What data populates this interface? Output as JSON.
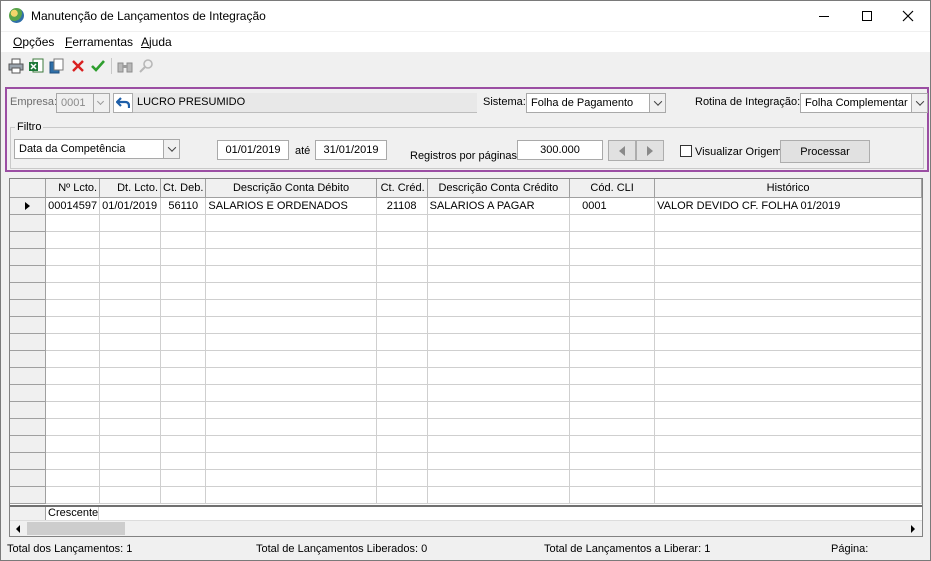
{
  "window": {
    "title": "Manutenção de Lançamentos de Integração"
  },
  "menu": {
    "items": [
      {
        "label": "Opções",
        "mnemonic": "O",
        "rest": "pções"
      },
      {
        "label": "Ferramentas",
        "mnemonic": "F",
        "rest": "erramentas"
      },
      {
        "label": "Ajuda",
        "mnemonic": "A",
        "rest": "juda"
      }
    ]
  },
  "toolbar": {
    "icons": [
      "print-icon",
      "excel-export-icon",
      "copy-icon",
      "cancel-icon",
      "confirm-icon",
      "binoculars-icon",
      "magnifier-icon"
    ]
  },
  "filter": {
    "empresa_label": "Empresa:",
    "empresa_code": "0001",
    "empresa_name": "LUCRO PRESUMIDO",
    "sistema_label": "Sistema:",
    "sistema_value": "Folha de Pagamento",
    "rotina_label": "Rotina de Integração:",
    "rotina_value": "Folha Complementar",
    "group_label": "Filtro",
    "date_type": "Data da Competência",
    "date_from": "01/01/2019",
    "ate_label": "até",
    "date_to": "31/01/2019",
    "registros_label": "Registros por páginas:",
    "registros_value": "300.000",
    "visualizar_label": "Visualizar Origem",
    "processar_label": "Processar"
  },
  "grid": {
    "columns": [
      "Nº Lcto.",
      "Dt. Lcto.",
      "Ct. Deb.",
      "Descrição Conta Débito",
      "Ct. Créd.",
      "Descrição Conta Crédito",
      "Cód. CLI",
      "Histórico"
    ],
    "rows": [
      [
        "00014597",
        "01/01/2019",
        "56110",
        "SALARIOS E ORDENADOS",
        "21108",
        "SALARIOS A PAGAR",
        "0001",
        "VALOR DEVIDO CF. FOLHA 01/2019"
      ]
    ],
    "footer_label": "Crescente"
  },
  "status": {
    "total_lancamentos": "Total dos Lançamentos: 1",
    "total_liberados": "Total de Lançamentos Liberados: 0",
    "total_a_liberar": "Total de Lançamentos a Liberar: 1",
    "pagina": "Página:"
  },
  "colors": {
    "panel_border": "#9b4ea3",
    "confirm_green": "#2e9e2e",
    "cancel_red": "#d92020"
  }
}
